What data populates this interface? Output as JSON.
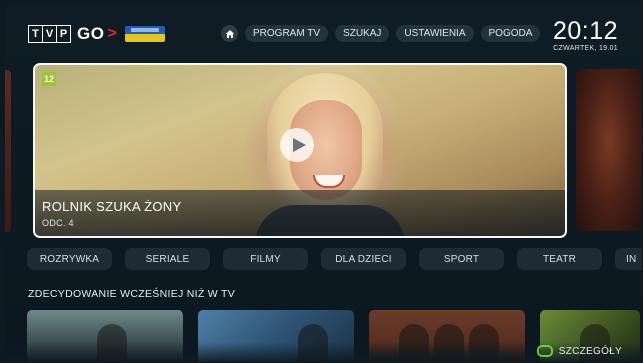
{
  "brand": {
    "tvp_letters": [
      "T",
      "V",
      "P"
    ],
    "go_label": "GO",
    "go_arrow": ">",
    "badge_icon": "ukraine-solidarity-badge"
  },
  "nav": {
    "home_icon": "home-icon",
    "items": [
      {
        "label": "PROGRAM TV"
      },
      {
        "label": "SZUKAJ"
      },
      {
        "label": "USTAWIENIA"
      },
      {
        "label": "POGODA"
      }
    ]
  },
  "clock": {
    "time": "20:12",
    "date": "CZWARTEK, 19.01"
  },
  "hero": {
    "age_rating": "12",
    "title": "ROLNIK SZUKA ŻONY",
    "subtitle": "ODC. 4",
    "play_icon": "play-icon"
  },
  "categories": [
    {
      "label": "ROZRYWKA"
    },
    {
      "label": "SERIALE"
    },
    {
      "label": "FILMY"
    },
    {
      "label": "DLA DZIECI"
    },
    {
      "label": "SPORT"
    },
    {
      "label": "TEATR"
    },
    {
      "label": "IN"
    }
  ],
  "section": {
    "title": "ZDECYDOWANIE WCZEŚNIEJ NIŻ W TV"
  },
  "footer_hint": {
    "label": "SZCZEGÓŁY",
    "key_icon": "green-button-icon"
  },
  "colors": {
    "background": "#0e1a22",
    "pill": "#24323c",
    "category_pill": "#1e2b34",
    "age_badge": "#9fc330",
    "brand_arrow": "#e2242c",
    "green_key": "#5fcf3a"
  }
}
